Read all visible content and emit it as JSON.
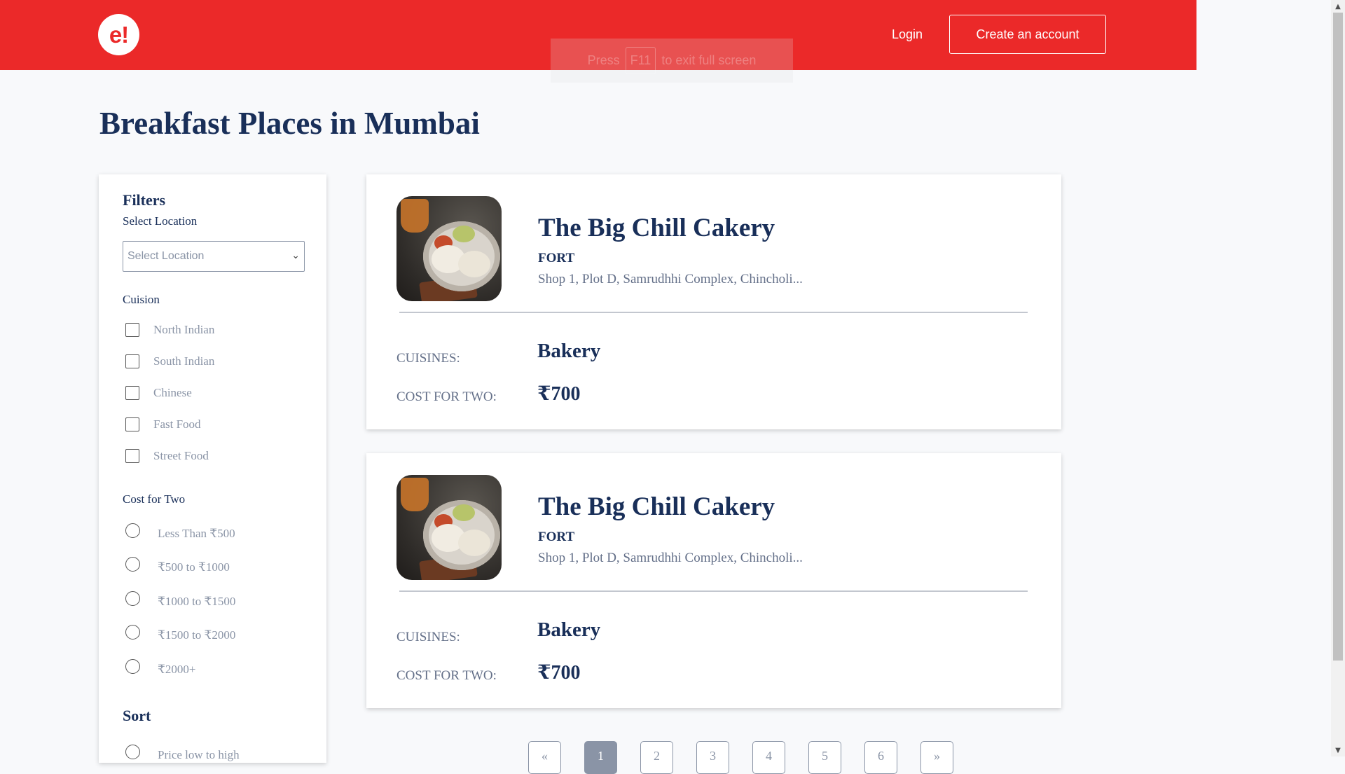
{
  "header": {
    "logo_text": "e!",
    "login_label": "Login",
    "create_account_label": "Create an account",
    "fullscreen_toast": {
      "press": "Press",
      "key": "F11",
      "suffix": "to exit full screen"
    }
  },
  "page_title": "Breakfast Places in Mumbai",
  "filters": {
    "heading": "Filters",
    "location_label": "Select Location",
    "location_placeholder": "Select Location",
    "cuisine_heading": "Cuision",
    "cuisines": [
      "North Indian",
      "South Indian",
      "Chinese",
      "Fast Food",
      "Street Food"
    ],
    "cost_heading": "Cost for Two",
    "cost_options": [
      "Less Than ₹500",
      "₹500 to ₹1000",
      "₹1000 to ₹1500",
      "₹1500 to ₹2000",
      "₹2000+"
    ],
    "sort_heading": "Sort",
    "sort_options": [
      "Price low to high"
    ]
  },
  "results": [
    {
      "name": "The Big Chill Cakery",
      "area": "FORT",
      "address": "Shop 1, Plot D, Samrudhhi Complex, Chincholi...",
      "cuisines_label": "CUISINES:",
      "cuisines_value": "Bakery",
      "cost_label": "COST FOR TWO:",
      "cost_value": "₹700"
    },
    {
      "name": "The Big Chill Cakery",
      "area": "FORT",
      "address": "Shop 1, Plot D, Samrudhhi Complex, Chincholi...",
      "cuisines_label": "CUISINES:",
      "cuisines_value": "Bakery",
      "cost_label": "COST FOR TWO:",
      "cost_value": "₹700"
    }
  ],
  "pagination": {
    "prev": "«",
    "pages": [
      "1",
      "2",
      "3",
      "4",
      "5",
      "6"
    ],
    "next": "»",
    "active_page": "1"
  },
  "colors": {
    "brand_red": "#eb2929",
    "navy_text": "#192f59",
    "muted_text": "#8a94a6"
  }
}
